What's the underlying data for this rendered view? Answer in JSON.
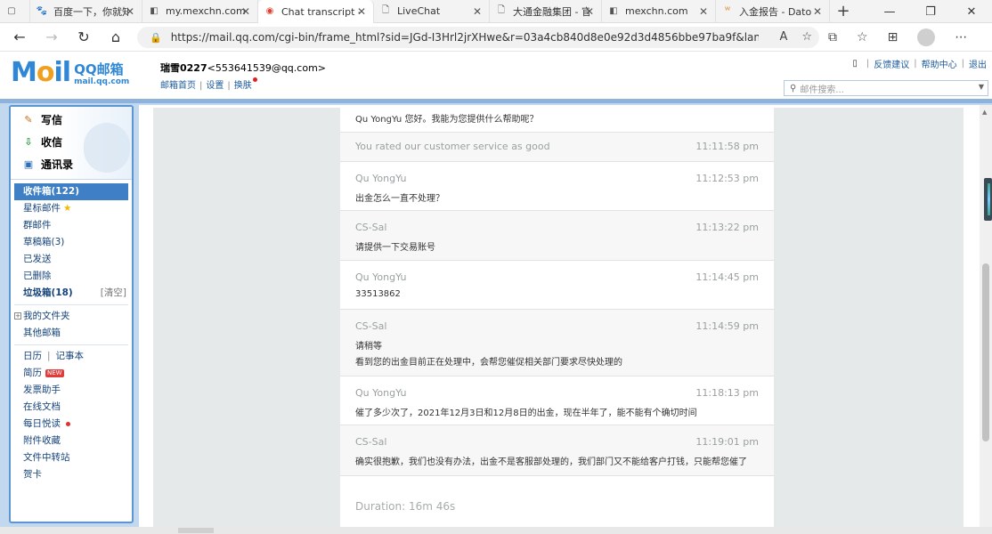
{
  "browser": {
    "tabs": [
      {
        "title": "百度一下，你就知道",
        "icon": "baidu-icon"
      },
      {
        "title": "my.mexchn.com",
        "icon": "page-icon"
      },
      {
        "title": "Chat transcript - QQ邮箱",
        "icon": "qqmail-icon",
        "active": true
      },
      {
        "title": "LiveChat",
        "icon": "document-icon"
      },
      {
        "title": "大通金融集团 - 官方网站",
        "icon": "document-icon"
      },
      {
        "title": "mexchn.com",
        "icon": "page-icon"
      },
      {
        "title": "入金报告 - Datong",
        "icon": "report-icon"
      }
    ],
    "url": "https://mail.qq.com/cgi-bin/frame_html?sid=JGd-I3Hrl2jrXHwe&r=03a4cb840d8e0e92d3d4856bbe97ba9f&lang=zh"
  },
  "mail": {
    "logo_main": "M",
    "logo_o": "o",
    "logo_tail": "il",
    "logo_qq": "QQ邮箱",
    "logo_domain": "mail.qq.com",
    "user_name": "瑞雪0227",
    "user_email": "<553641539@qq.com>",
    "links": {
      "home": "邮箱首页",
      "settings": "设置",
      "skin": "换肤"
    },
    "top_links": {
      "feedback": "反馈建议",
      "help": "帮助中心",
      "logout": "退出"
    },
    "search_placeholder": "邮件搜索..."
  },
  "sidebar": {
    "compose": "写信",
    "inbox_quick": "收信",
    "contacts": "通讯录",
    "folders": [
      {
        "label": "收件箱(122)"
      },
      {
        "label": "星标邮件"
      },
      {
        "label": "群邮件"
      },
      {
        "label": "草稿箱(3)"
      },
      {
        "label": "已发送"
      },
      {
        "label": "已删除"
      },
      {
        "label": "垃圾箱(18)",
        "action": "[清空]"
      }
    ],
    "my_folders": "我的文件夹",
    "other_mailbox": "其他邮箱",
    "calendar": "日历",
    "notes": "记事本",
    "resume": "简历",
    "resume_badge": "NEW",
    "tools": [
      "发票助手",
      "在线文档",
      "每日悦读",
      "附件收藏",
      "文件中转站",
      "贺卡"
    ]
  },
  "transcript": {
    "messages": [
      {
        "author": "",
        "time": "",
        "text": "Qu YongYu 您好。我能为您提供什么帮助呢？"
      },
      {
        "author": "You rated our customer service as good",
        "time": "11:11:58 pm",
        "text": ""
      },
      {
        "author": "Qu YongYu",
        "time": "11:12:53 pm",
        "text": "出金怎么一直不处理？"
      },
      {
        "author": "CS-Sal",
        "time": "11:13:22 pm",
        "text": "请提供一下交易账号"
      },
      {
        "author": "Qu YongYu",
        "time": "11:14:45 pm",
        "text": "33513862"
      },
      {
        "author": "CS-Sal",
        "time": "11:14:59 pm",
        "text": "请稍等",
        "text2": "看到您的出金目前正在处理中，会帮您催促相关部门要求尽快处理的"
      },
      {
        "author": "Qu YongYu",
        "time": "11:18:13 pm",
        "text": "催了多少次了，2021年12月3日和12月8日的出金，现在半年了，能不能有个确切时间"
      },
      {
        "author": "CS-Sal",
        "time": "11:19:01 pm",
        "text": "确实很抱歉，我们也没有办法，出金不是客服部处理的，我们部门又不能给客户打钱，只能帮您催了"
      }
    ],
    "duration": "Duration: 16m 46s"
  }
}
